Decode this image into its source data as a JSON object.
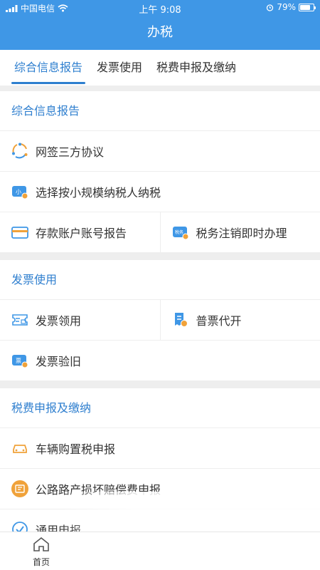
{
  "status_bar": {
    "carrier": "中国电信",
    "time": "上午 9:08",
    "battery": "79%",
    "battery_level": 0.79
  },
  "nav": {
    "title": "办税"
  },
  "tabs": [
    {
      "label": "综合信息报告",
      "active": true
    },
    {
      "label": "发票使用",
      "active": false
    },
    {
      "label": "税费申报及缴纳",
      "active": false
    }
  ],
  "sections": [
    {
      "title": "综合信息报告",
      "items": [
        {
          "label": "网签三方协议",
          "icon": "agreement-icon"
        },
        {
          "label": "选择按小规模纳税人纳税",
          "icon": "small-scale-icon",
          "icon_text": "小"
        },
        {
          "label": "存款账户账号报告",
          "icon": "bank-card-icon"
        },
        {
          "label": "税务注销即时办理",
          "icon": "tax-cancel-icon",
          "icon_text": "税务"
        }
      ]
    },
    {
      "title": "发票使用",
      "items": [
        {
          "label": "发票领用",
          "icon": "invoice-collect-icon"
        },
        {
          "label": "普票代开",
          "icon": "invoice-issue-icon"
        },
        {
          "label": "发票验旧",
          "icon": "invoice-verify-icon",
          "icon_text": "票"
        }
      ]
    },
    {
      "title": "税费申报及缴纳",
      "items": [
        {
          "label": "车辆购置税申报",
          "icon": "car-icon"
        },
        {
          "label": "公路路产损坏赔偿费申报",
          "icon": "road-icon"
        },
        {
          "label": "通用申报",
          "icon": "check-icon"
        }
      ]
    }
  ],
  "tab_bar": {
    "home": "首页"
  },
  "colors": {
    "primary": "#3f97e6",
    "accent": "#2e7fcf",
    "orange": "#f0a23a"
  }
}
